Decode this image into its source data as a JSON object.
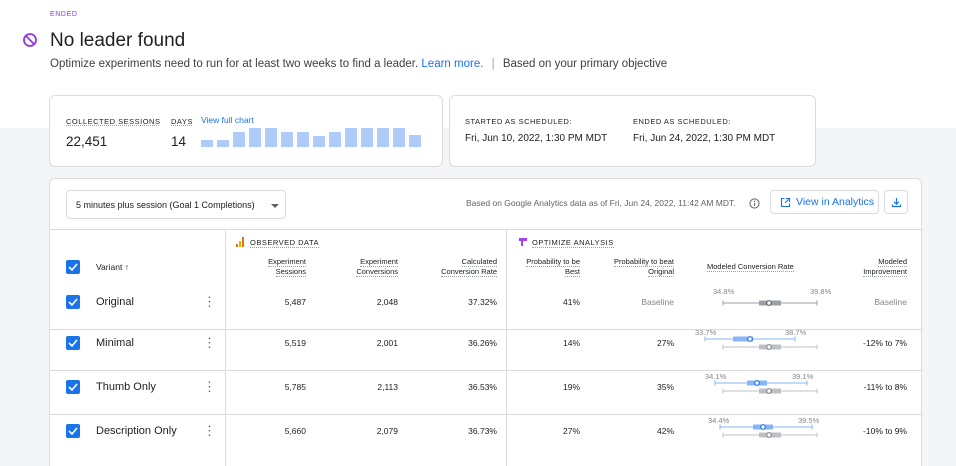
{
  "status": "ENDED",
  "title": "No leader found",
  "description": {
    "text": "Optimize experiments need to run for at least two weeks to find a leader.",
    "link": "Learn more.",
    "separator": "|",
    "suffix": "Based on your primary objective"
  },
  "stats": {
    "sessions_label": "COLLECTED SESSIONS",
    "sessions_value": "22,451",
    "days_label": "DAYS",
    "days_value": "14",
    "view_chart": "View full chart",
    "daily_bar_levels": [
      0.35,
      0.35,
      0.75,
      0.95,
      0.95,
      0.75,
      0.75,
      0.55,
      0.75,
      0.95,
      0.95,
      0.95,
      0.95,
      0.6
    ]
  },
  "schedule": {
    "started_label": "STARTED AS SCHEDULED:",
    "started_value": "Fri, Jun 10, 2022, 1:30 PM MDT",
    "ended_label": "ENDED AS SCHEDULED:",
    "ended_value": "Fri, Jun 24, 2022, 1:30 PM MDT"
  },
  "toolbar": {
    "objective": "5 minutes plus session (Goal 1 Completions)",
    "ga_note": "Based on Google Analytics data as of Fri, Jun 24, 2022, 11:42 AM MDT.",
    "view_analytics": "View in Analytics"
  },
  "table": {
    "observed_label": "OBSERVED DATA",
    "optimize_label": "OPTIMIZE ANALYSIS",
    "variant_header": "Variant",
    "sort_arrow": "↑",
    "headers": {
      "sessions": [
        "Experiment",
        "Sessions"
      ],
      "conversions": [
        "Experiment",
        "Conversions"
      ],
      "rate": [
        "Calculated",
        "Conversion Rate"
      ],
      "prob_best": [
        "Probability to be",
        "Best"
      ],
      "prob_beat": [
        "Probability to beat",
        "Original"
      ],
      "modeled_rate": "Modeled Conversion Rate",
      "improvement": [
        "Modeled",
        "Improvement"
      ]
    },
    "rows": [
      {
        "name": "Original",
        "sessions": "5,487",
        "conversions": "2,048",
        "rate": "37.32%",
        "prob_best": "41%",
        "prob_beat": "Baseline",
        "ci_low": "34.8%",
        "ci_high": "39.8%",
        "improvement": "Baseline"
      },
      {
        "name": "Minimal",
        "sessions": "5,519",
        "conversions": "2,001",
        "rate": "36.26%",
        "prob_best": "14%",
        "prob_beat": "27%",
        "ci_low": "33.7%",
        "ci_high": "38.7%",
        "improvement": "-12% to 7%"
      },
      {
        "name": "Thumb Only",
        "sessions": "5,785",
        "conversions": "2,113",
        "rate": "36.53%",
        "prob_best": "19%",
        "prob_beat": "35%",
        "ci_low": "34.1%",
        "ci_high": "39.1%",
        "improvement": "-11% to 8%"
      },
      {
        "name": "Description Only",
        "sessions": "5,660",
        "conversions": "2,079",
        "rate": "36.73%",
        "prob_best": "27%",
        "prob_beat": "42%",
        "ci_low": "34.4%",
        "ci_high": "39.5%",
        "improvement": "-10% to 9%"
      }
    ]
  },
  "colors": {
    "accent": "#1a73e8",
    "status_purple": "#9334e6",
    "baseline_gray": "#9aa0a6",
    "variant_blue": "#8ab4f8"
  }
}
